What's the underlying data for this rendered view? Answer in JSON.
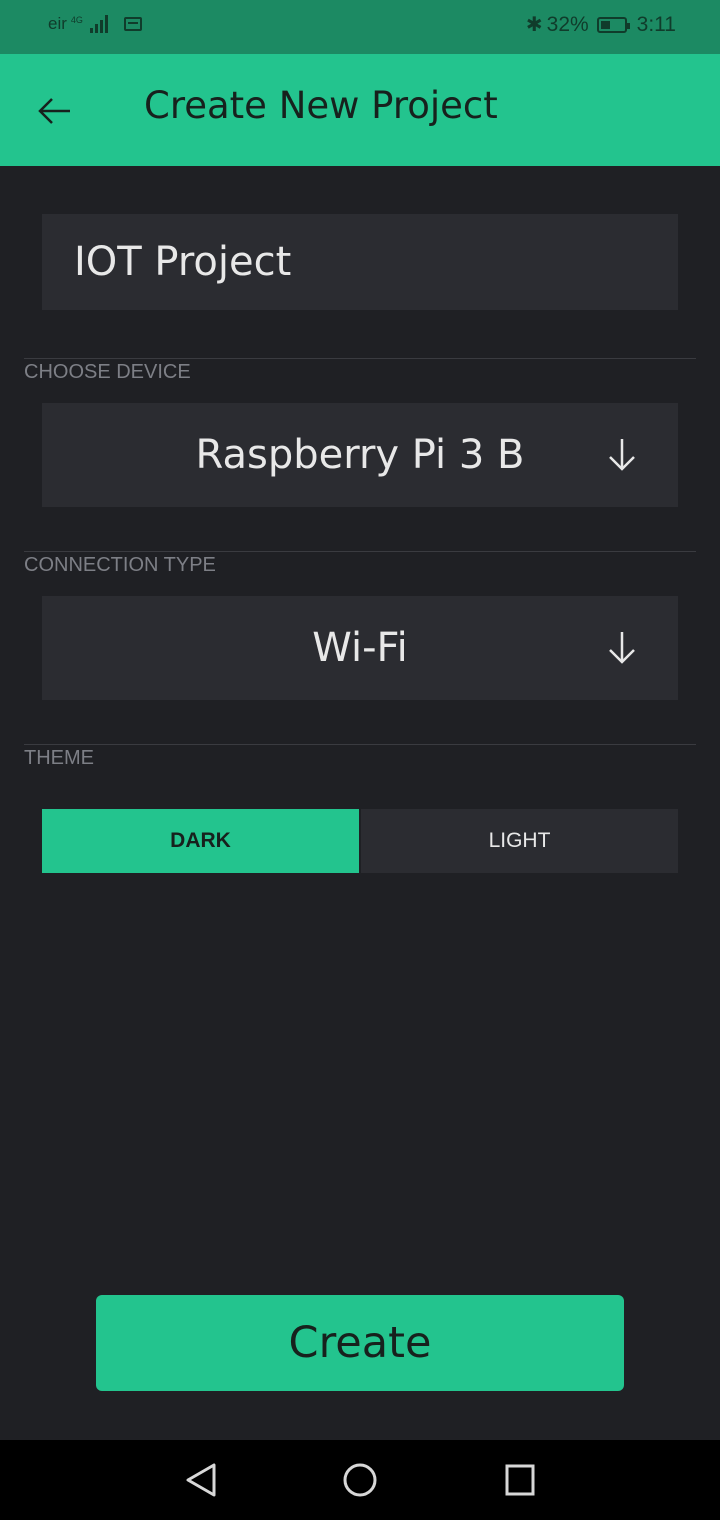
{
  "status_bar": {
    "carrier": "eir",
    "network_type": "4G",
    "battery_percent": "32%",
    "time": "3:11"
  },
  "app_bar": {
    "title": "Create New Project",
    "back_icon": "arrow-left-icon"
  },
  "form": {
    "project_name": {
      "value": "IOT Project"
    },
    "device": {
      "label": "CHOOSE DEVICE",
      "value": "Raspberry Pi 3 B",
      "icon": "arrow-down-icon"
    },
    "connection": {
      "label": "CONNECTION TYPE",
      "value": "Wi-Fi",
      "icon": "arrow-down-icon"
    },
    "theme": {
      "label": "THEME",
      "options": [
        "DARK",
        "LIGHT"
      ],
      "selected": "DARK"
    }
  },
  "actions": {
    "create_label": "Create"
  },
  "colors": {
    "accent": "#23c48e",
    "background": "#1f2024",
    "field": "#2b2c31",
    "status_bar": "#1c8a63"
  }
}
